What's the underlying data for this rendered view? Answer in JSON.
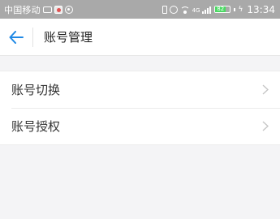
{
  "status_bar": {
    "carrier": "中国移动",
    "network": "4G",
    "battery": "82",
    "time": "13:34"
  },
  "header": {
    "title": "账号管理",
    "accent_color": "#1e88e5"
  },
  "menu": {
    "items": [
      {
        "label": "账号切换",
        "icon": "chevron-right-icon"
      },
      {
        "label": "账号授权",
        "icon": "chevron-right-icon"
      }
    ]
  }
}
